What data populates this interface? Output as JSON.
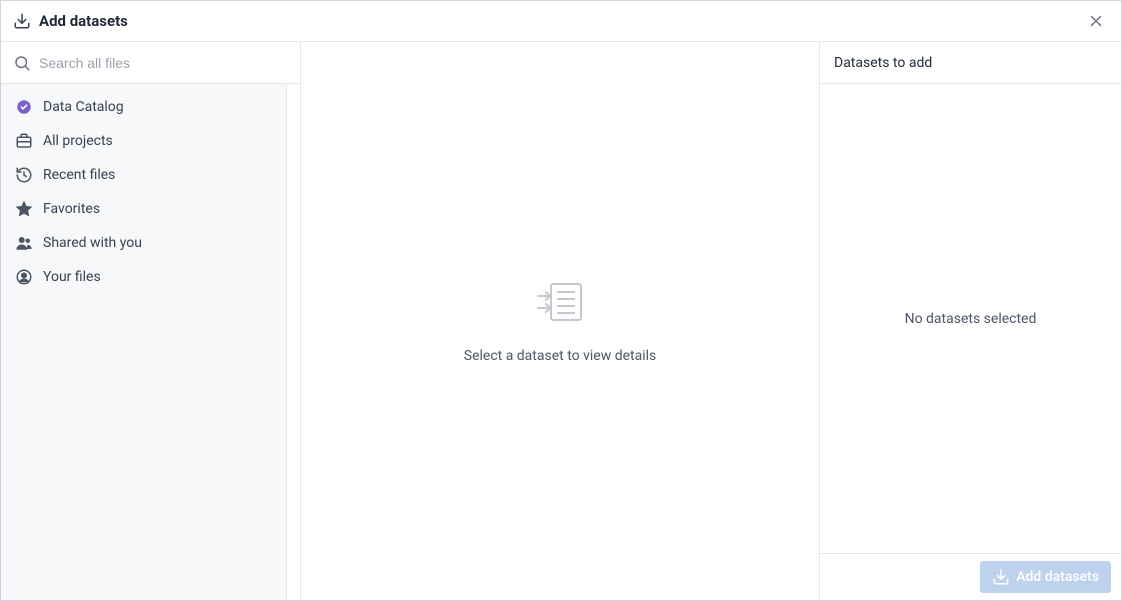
{
  "header": {
    "title": "Add datasets"
  },
  "search": {
    "placeholder": "Search all files"
  },
  "sidebar": {
    "items": [
      {
        "label": "Data Catalog"
      },
      {
        "label": "All projects"
      },
      {
        "label": "Recent files"
      },
      {
        "label": "Favorites"
      },
      {
        "label": "Shared with you"
      },
      {
        "label": "Your files"
      }
    ]
  },
  "center": {
    "empty_text": "Select a dataset to view details"
  },
  "right": {
    "heading": "Datasets to add",
    "empty_text": "No datasets selected",
    "button_label": "Add datasets"
  }
}
